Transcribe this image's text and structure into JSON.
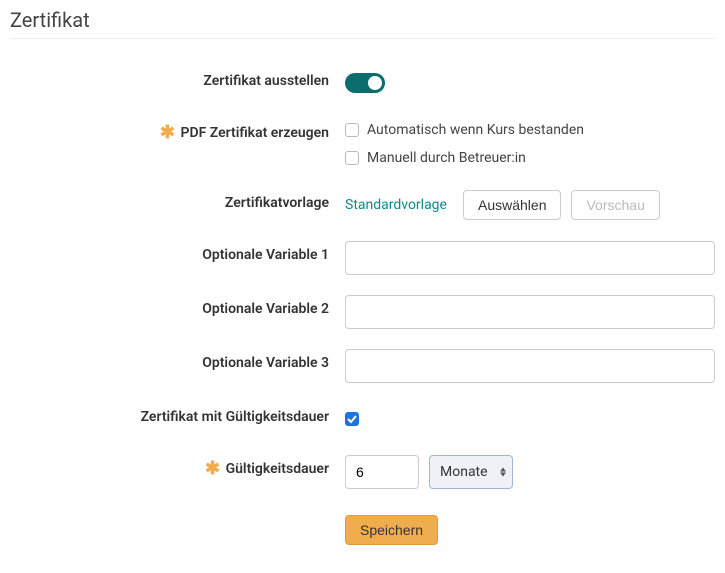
{
  "title": "Zertifikat",
  "fields": {
    "issue": {
      "label": "Zertifikat ausstellen",
      "enabled": true
    },
    "pdf": {
      "label": "PDF Zertifikat erzeugen",
      "required": true,
      "options": {
        "auto": {
          "label": "Automatisch wenn Kurs bestanden",
          "checked": false
        },
        "manual": {
          "label": "Manuell durch Betreuer:in",
          "checked": false
        }
      }
    },
    "template": {
      "label": "Zertifikatvorlage",
      "value": "Standardvorlage",
      "select_button": "Auswählen",
      "preview_button": "Vorschau"
    },
    "var1": {
      "label": "Optionale Variable 1",
      "value": ""
    },
    "var2": {
      "label": "Optionale Variable 2",
      "value": ""
    },
    "var3": {
      "label": "Optionale Variable 3",
      "value": ""
    },
    "validity_enabled": {
      "label": "Zertifikat mit Gültigkeitsdauer",
      "checked": true
    },
    "validity": {
      "label": "Gültigkeitsdauer",
      "required": true,
      "value": "6",
      "unit": "Monate"
    }
  },
  "actions": {
    "save": "Speichern"
  }
}
